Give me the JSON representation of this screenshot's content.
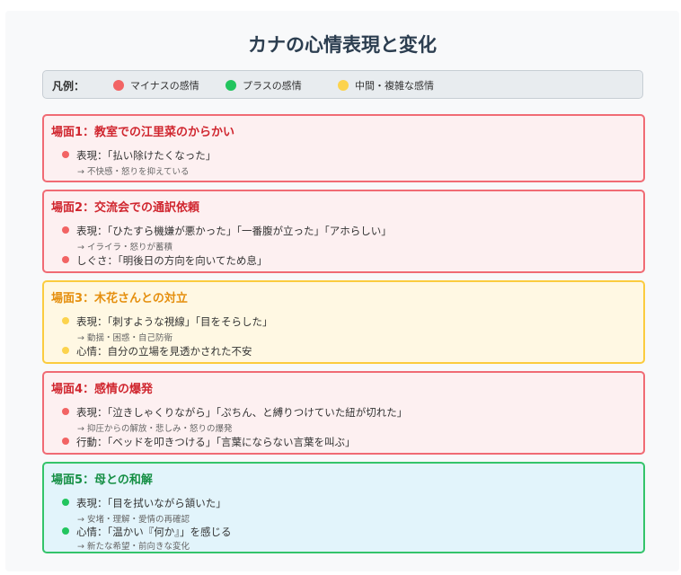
{
  "title": "カナの心情表現と変化",
  "legend": {
    "label": "凡例：",
    "items": [
      {
        "label": "マイナスの感情",
        "color": "#f26464"
      },
      {
        "label": "プラスの感情",
        "color": "#22c55e"
      },
      {
        "label": "中間・複雑な感情",
        "color": "#fcd34d"
      }
    ]
  },
  "scenes": [
    {
      "title": "場面1：教室での江里菜のからかい",
      "border": "#f06b74",
      "bg": "#fdf0f1",
      "title_color": "#d0262f",
      "dot": "#f26464",
      "rows": [
        {
          "text": "表現：「払い除けたくなった」",
          "sub": "→ 不快感・怒りを抑えている"
        }
      ]
    },
    {
      "title": "場面2：交流会での通訳依頼",
      "border": "#f06b74",
      "bg": "#fdf0f1",
      "title_color": "#d0262f",
      "dot": "#f26464",
      "rows": [
        {
          "text": "表現：「ひたすら機嫌が悪かった」「一番腹が立った」「アホらしい」",
          "sub": "→ イライラ・怒りが蓄積"
        },
        {
          "text": "しぐさ：「明後日の方向を向いてため息」",
          "sub": ""
        }
      ]
    },
    {
      "title": "場面3：木花さんとの対立",
      "border": "#fbcc3f",
      "bg": "#fff8e3",
      "title_color": "#e58f0e",
      "dot": "#fcd34d",
      "rows": [
        {
          "text": "表現：「刺すような視線」「目をそらした」",
          "sub": "→ 動揺・困惑・自己防衛"
        },
        {
          "text": "心情：自分の立場を見透かされた不安",
          "sub": ""
        }
      ]
    },
    {
      "title": "場面4：感情の爆発",
      "border": "#f06b74",
      "bg": "#fdf0f1",
      "title_color": "#d0262f",
      "dot": "#f26464",
      "rows": [
        {
          "text": "表現：「泣きしゃくりながら」「ぷちん、と縛りつけていた紐が切れた」",
          "sub": "→ 抑圧からの解放・悲しみ・怒りの爆発"
        },
        {
          "text": "行動：「ベッドを叩きつける」「言葉にならない言葉を叫ぶ」",
          "sub": ""
        }
      ]
    },
    {
      "title": "場面5：母との和解",
      "border": "#34c46a",
      "bg": "#e2f4fb",
      "title_color": "#158f44",
      "dot": "#22c55e",
      "rows": [
        {
          "text": "表現：「目を拭いながら頷いた」",
          "sub": "→ 安堵・理解・愛情の再確認"
        },
        {
          "text": "心情：「温かい『何か』」を感じる",
          "sub": "→ 新たな希望・前向きな変化"
        }
      ]
    }
  ]
}
